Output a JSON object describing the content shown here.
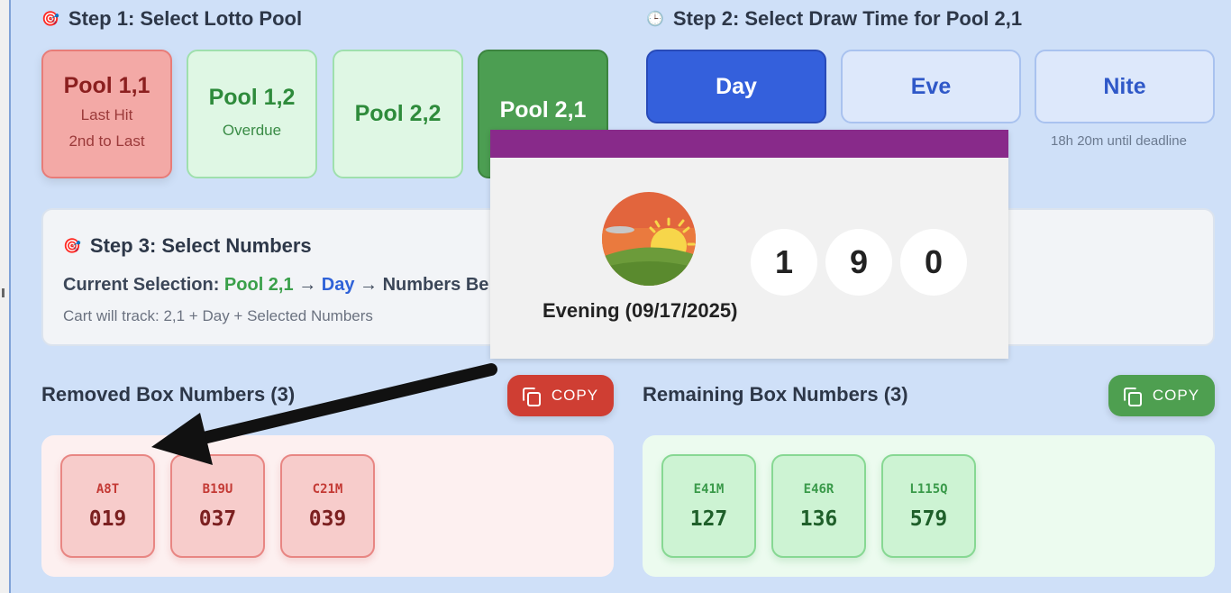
{
  "step1": {
    "title": "Step 1: Select Lotto Pool",
    "icon": "target-icon"
  },
  "pools": [
    {
      "name": "Pool 1,1",
      "sub1": "Last Hit",
      "sub2": "2nd to Last"
    },
    {
      "name": "Pool 1,2",
      "sub1": "Overdue"
    },
    {
      "name": "Pool 2,2"
    },
    {
      "name": "Pool 2,1"
    }
  ],
  "step2": {
    "title": "Step 2: Select Draw Time for Pool 2,1",
    "icon": "clock-icon",
    "options": [
      "Day",
      "Eve",
      "Nite"
    ],
    "deadline": "18h 20m until deadline"
  },
  "step3": {
    "title": "Step 3: Select Numbers",
    "current_label": "Current Selection:",
    "pool": "Pool 2,1",
    "arrow": "→",
    "draw": "Day",
    "numbers": "Numbers Be",
    "cart": "Cart will track: 2,1 + Day + Selected Numbers"
  },
  "removed": {
    "title": "Removed Box Numbers (3)",
    "copy_label": "COPY",
    "items": [
      {
        "code": "A8T",
        "num": "019"
      },
      {
        "code": "B19U",
        "num": "037"
      },
      {
        "code": "C21M",
        "num": "039"
      }
    ]
  },
  "remaining": {
    "title": "Remaining Box Numbers (3)",
    "copy_label": "COPY",
    "items": [
      {
        "code": "E41M",
        "num": "127"
      },
      {
        "code": "E46R",
        "num": "136"
      },
      {
        "code": "L115Q",
        "num": "579"
      }
    ]
  },
  "popup": {
    "icon": "sunset-icon",
    "balls": [
      "1",
      "9",
      "0"
    ],
    "label": "Evening (09/17/2025)",
    "bar_color": "#882a8a"
  },
  "colors": {
    "background": "#cfe0f8",
    "active_blue": "#3460dc",
    "selected_green": "#4c9e52",
    "copy_red": "#cf3e33",
    "copy_green": "#4e9f50"
  }
}
